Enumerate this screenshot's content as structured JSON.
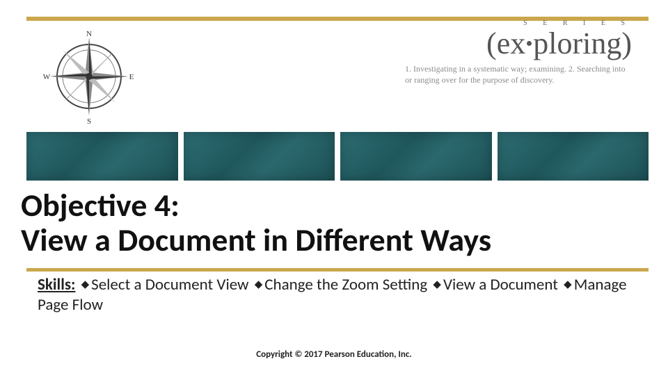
{
  "brand": {
    "series": "S E R I E S",
    "word_open": "(ex",
    "word_close": "ploring)",
    "definition": "1. Investigating in a systematic way; examining. 2. Searching into or ranging over for the purpose of discovery."
  },
  "compass": {
    "n": "N",
    "e": "E",
    "s": "S",
    "w": "W"
  },
  "title_line1": "Objective 4:",
  "title_line2": "View a Document in Different Ways",
  "skills": {
    "label": "Skills:",
    "items": [
      "Select a Document View",
      "Change the Zoom Setting",
      "View a Document",
      "Manage Page Flow"
    ]
  },
  "footer": "Copyright © 2017 Pearson Education, Inc."
}
